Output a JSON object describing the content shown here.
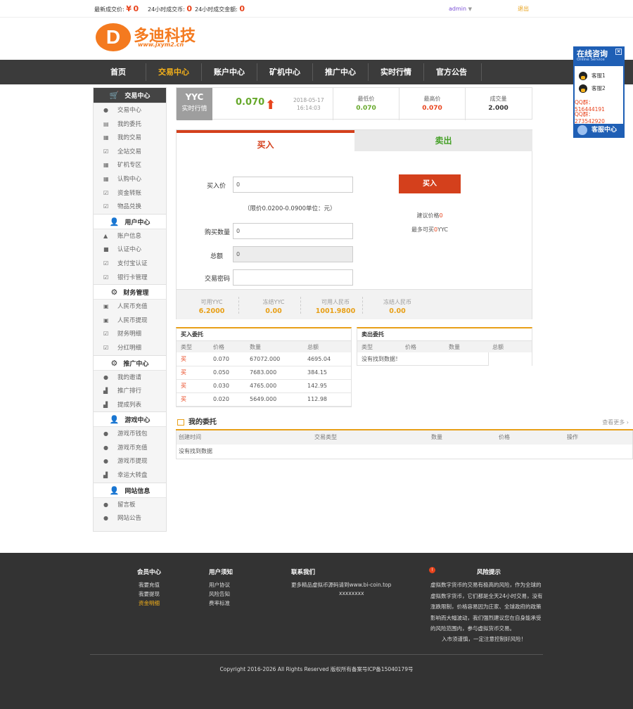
{
  "topbar": {
    "last_price_label": "最新成交价:",
    "last_price_currency": "¥",
    "last_price_value": "0",
    "volume_24h_label": "24小时成交币:",
    "volume_24h_value": "0",
    "amount_24h_label": "24小时成交金额:",
    "amount_24h_value": "0",
    "username": "admin",
    "logout": "退出"
  },
  "brand": {
    "logo_letter": "D",
    "name": "多迪科技",
    "url": "www.jxym2.cn",
    "logo_color": "#f47a1f"
  },
  "nav": {
    "items": [
      "首页",
      "交易中心",
      "账户中心",
      "矿机中心",
      "推广中心",
      "实时行情",
      "官方公告"
    ],
    "active_color": "#f5b11a"
  },
  "sidebar": {
    "sections": [
      {
        "title": "交易中心",
        "icon": "cart-icon",
        "items": [
          "交易中心",
          "我的委托",
          "我的交易",
          "全站交易",
          "矿机专区",
          "认购中心",
          "资金转账",
          "物品兑换"
        ]
      },
      {
        "title": "用户中心",
        "icon": "user-gear-icon",
        "items": [
          "账户信息",
          "认证中心",
          "支付宝认证",
          "银行卡管理"
        ]
      },
      {
        "title": "财务管理",
        "icon": "gear-icon",
        "items": [
          "人民币充值",
          "人民币提现",
          "财务明细",
          "分红明细"
        ]
      },
      {
        "title": "推广中心",
        "icon": "gear-icon",
        "items": [
          "我的邀请",
          "推广排行",
          "提成列表"
        ]
      },
      {
        "title": "游戏中心",
        "icon": "user-gear-icon",
        "items": [
          "游戏币钱包",
          "游戏币充值",
          "游戏币提现",
          "幸运大转盘"
        ]
      },
      {
        "title": "网站信息",
        "icon": "user-gear-icon",
        "items": [
          "留言板",
          "网站公告"
        ]
      }
    ]
  },
  "ticker": {
    "code": "YYC",
    "sub": "实时行情",
    "price": "0.070",
    "date": "2018-05-17",
    "time": "16:14:03",
    "low_label": "最低价",
    "low_value": "0.070",
    "high_label": "最高价",
    "high_value": "0.070",
    "volume_label": "成交量",
    "volume_value": "2.000",
    "up_color": "#66a82a",
    "down_color": "#e8431c"
  },
  "trade": {
    "tab_buy": "买入",
    "tab_sell": "卖出",
    "buy_price_label": "买入价",
    "buy_price_value": "0",
    "price_range_hint": "（限价0.0200-0.0900单位：元）",
    "quantity_label": "购买数量",
    "quantity_value": "0",
    "total_label": "总额",
    "total_value": "0",
    "password_label": "交易密码",
    "password_value": "",
    "buy_button": "买入",
    "suggest_price_label": "建议价格",
    "suggest_price_value": "0",
    "max_buy_label": "最多可买",
    "max_buy_value": "0",
    "max_buy_unit": "YYC"
  },
  "balances": [
    {
      "label": "可用YYC",
      "value": "6.2000"
    },
    {
      "label": "冻结YYC",
      "value": "0.00"
    },
    {
      "label": "可用人民币",
      "value": "1001.9800"
    },
    {
      "label": "冻结人民币",
      "value": "0.00"
    }
  ],
  "buy_orders": {
    "title": "买入委托",
    "columns": [
      "类型",
      "价格",
      "数量",
      "总额"
    ],
    "rows": [
      [
        "买",
        "0.070",
        "67072.000",
        "4695.04"
      ],
      [
        "买",
        "0.050",
        "7683.000",
        "384.15"
      ],
      [
        "买",
        "0.030",
        "4765.000",
        "142.95"
      ],
      [
        "买",
        "0.020",
        "5649.000",
        "112.98"
      ]
    ]
  },
  "sell_orders": {
    "title": "卖出委托",
    "columns": [
      "类型",
      "价格",
      "数量",
      "总额"
    ],
    "empty": "没有找到数据！"
  },
  "my_orders": {
    "title": "我的委托",
    "more": "查看更多 ›",
    "columns": [
      "创建时间",
      "交易类型",
      "数量",
      "价格",
      "操作"
    ],
    "empty": "没有找到数据"
  },
  "footer": {
    "col1_title": "会员中心",
    "col1_links": [
      "我要充值",
      "我要提现",
      "资金明细"
    ],
    "col2_title": "用户须知",
    "col2_links": [
      "用户协议",
      "风险告知",
      "费率标准"
    ],
    "col3_title": "联系我们",
    "col3_line1": "更多精品虚拟币源码请到www.bi-coin.top",
    "col3_line2": "xxxxxxxx",
    "risk_title": "风险提示",
    "risk_text": "虚拟数字货币的交易有极高的风险，作为全球的虚拟数字货币，它们都是全天24小时交易，没有涨跌限制，价格容易因为庄家、全球政府的政策影响而大幅波动，我们强烈建议您在自身能承受的风险范围内，参与虚拟货币交易。",
    "risk_slogan": "入市须谨慎，一定注意控制好风险！",
    "copyright": "Copyright 2016-2026 All Rights Reserved 版权所有备案号ICP备15040179号"
  },
  "service": {
    "title": "在线咨询",
    "subtitle": "Online Service",
    "agent1": "客服1",
    "agent2": "客服2",
    "qq_group1": "QQ群：516444191",
    "qq_group2": "QQ群：273542920",
    "bottom": "客服中心",
    "close": "×"
  }
}
